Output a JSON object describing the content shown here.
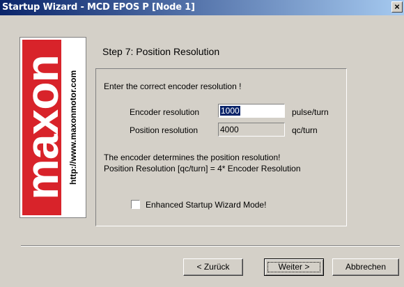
{
  "window": {
    "title": "Startup Wizard - MCD EPOS P [Node 1]",
    "close_glyph": "×"
  },
  "logo": {
    "brand": "maxon",
    "url": "http://www.maxonmotor.com",
    "brand_color": "#d8232a"
  },
  "step": {
    "title": "Step 7: Position Resolution"
  },
  "form": {
    "instruction": "Enter the correct encoder resolution !",
    "encoder_label": "Encoder resolution",
    "encoder_value": "1000",
    "encoder_unit": "pulse/turn",
    "position_label": "Position resolution",
    "position_value": "4000",
    "position_unit": "qc/turn",
    "note_line1": "The encoder determines the position resolution!",
    "note_line2": "Position Resolution [qc/turn] = 4* Encoder Resolution",
    "checkbox_label": "Enhanced Startup Wizard Mode!",
    "checkbox_checked": false
  },
  "buttons": {
    "back": "< Zurück",
    "next": "Weiter >",
    "cancel": "Abbrechen"
  }
}
